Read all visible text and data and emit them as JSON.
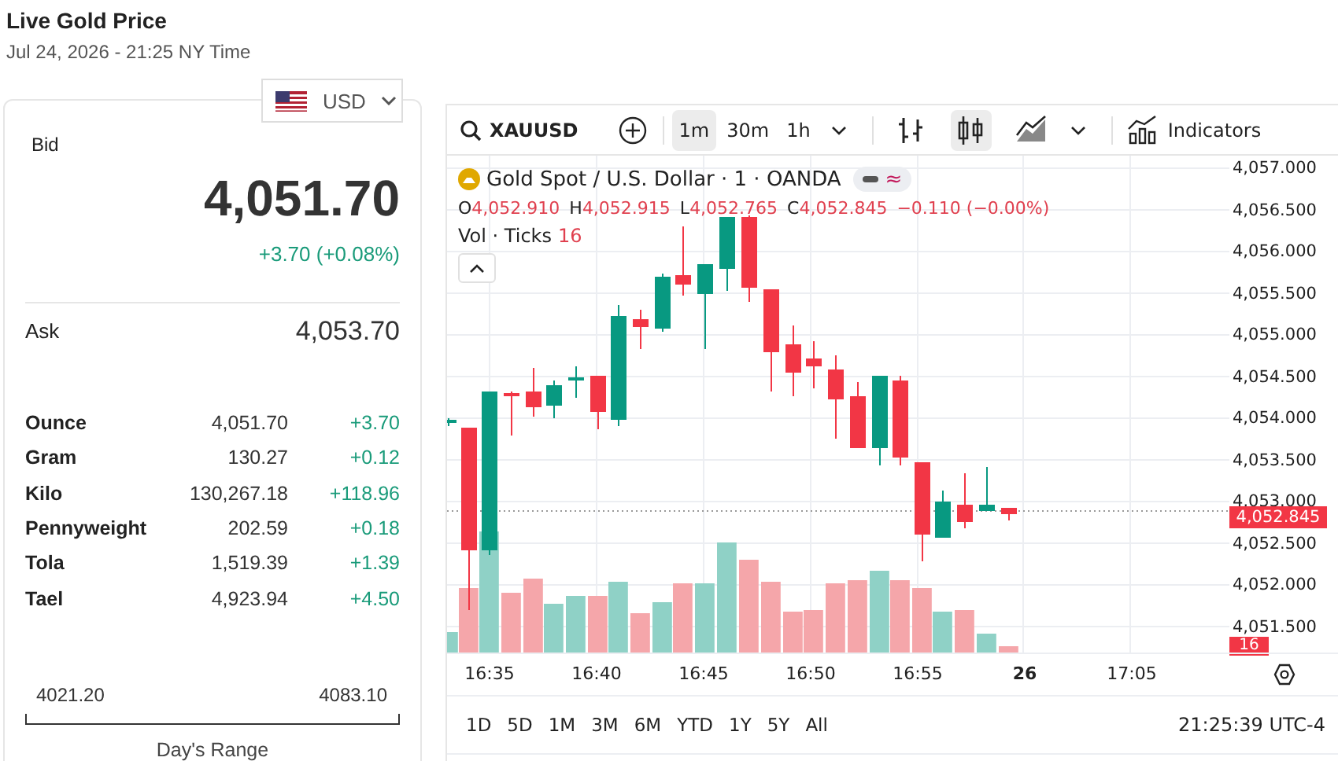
{
  "header": {
    "title": "Live Gold Price",
    "subtitle": "Jul 24, 2026 - 21:25 NY Time"
  },
  "currency_selector": {
    "value": "USD"
  },
  "quote": {
    "bid_label": "Bid",
    "bid": "4,051.70",
    "change": "+3.70 (+0.08%)",
    "ask_label": "Ask",
    "ask": "4,053.70"
  },
  "units": [
    {
      "name": "Ounce",
      "price": "4,051.70",
      "change": "+3.70"
    },
    {
      "name": "Gram",
      "price": "130.27",
      "change": "+0.12"
    },
    {
      "name": "Kilo",
      "price": "130,267.18",
      "change": "+118.96"
    },
    {
      "name": "Pennyweight",
      "price": "202.59",
      "change": "+0.18"
    },
    {
      "name": "Tola",
      "price": "1,519.39",
      "change": "+1.39"
    },
    {
      "name": "Tael",
      "price": "4,923.94",
      "change": "+4.50"
    }
  ],
  "days_range": {
    "low": "4021.20",
    "high": "4083.10",
    "label": "Day's Range"
  },
  "chart": {
    "toolbar": {
      "symbol": "XAUUSD",
      "intervals": [
        {
          "label": "1m",
          "selected": true
        },
        {
          "label": "30m",
          "selected": false
        },
        {
          "label": "1h",
          "selected": false
        }
      ],
      "chart_types": [
        {
          "kind": "bars",
          "selected": false
        },
        {
          "kind": "candles",
          "selected": true
        },
        {
          "kind": "area",
          "selected": false
        }
      ],
      "indicators": "Indicators"
    },
    "legend": {
      "title": "Gold Spot / U.S. Dollar · 1 · OANDA",
      "badge": "≈",
      "ohlc": [
        {
          "key": "O",
          "value": "4,052.910"
        },
        {
          "key": "H",
          "value": "4,052.915"
        },
        {
          "key": "L",
          "value": "4,052.765"
        },
        {
          "key": "C",
          "value": "4,052.845"
        }
      ],
      "change": "−0.110 (−0.00%)",
      "volume_label": "Vol · Ticks",
      "volume_value": "16"
    },
    "price_axis": [
      "4,057.000",
      "4,056.500",
      "4,056.000",
      "4,055.500",
      "4,055.000",
      "4,054.500",
      "4,054.000",
      "4,053.500",
      "4,053.000",
      "4,052.500",
      "4,052.000",
      "4,051.500"
    ],
    "price_label": "4,052.845",
    "volume_tag": "16",
    "time_axis": [
      {
        "label": "16:35",
        "kind": "time"
      },
      {
        "label": "16:40",
        "kind": "time"
      },
      {
        "label": "16:45",
        "kind": "time"
      },
      {
        "label": "16:50",
        "kind": "time"
      },
      {
        "label": "16:55",
        "kind": "time"
      },
      {
        "label": "26",
        "kind": "day"
      },
      {
        "label": "17:05",
        "kind": "time"
      }
    ],
    "ranges": [
      "1D",
      "5D",
      "1M",
      "3M",
      "6M",
      "YTD",
      "1Y",
      "5Y",
      "All"
    ],
    "clock": "21:25:39 UTC-4"
  }
}
